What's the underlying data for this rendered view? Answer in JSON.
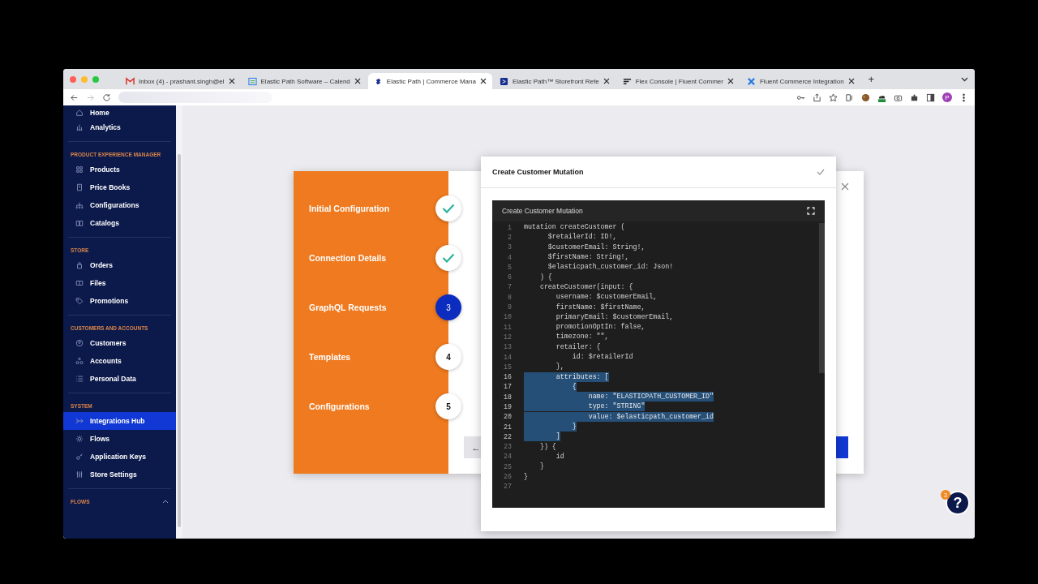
{
  "browser": {
    "tabs": [
      {
        "title": "Inbox (4) - prashant.singh@el",
        "kind": "mail",
        "selected": false
      },
      {
        "title": "Elastic Path Software – Calend",
        "kind": "calendar",
        "selected": false
      },
      {
        "title": "Elastic Path | Commerce Mana",
        "kind": "swirl",
        "selected": true
      },
      {
        "title": "Elastic Path™ Storefront Refe",
        "kind": "square",
        "selected": false
      },
      {
        "title": "Flex Console | Fluent Commer",
        "kind": "lines",
        "selected": false
      },
      {
        "title": "Fluent Commerce Integration",
        "kind": "cross",
        "selected": false
      }
    ],
    "new_tab": "+",
    "avatar": "P"
  },
  "sidebar": {
    "sections": [
      {
        "items": [
          {
            "label": "Home",
            "kind": "home",
            "selected": false
          },
          {
            "label": "Analytics",
            "kind": "chart",
            "selected": false
          }
        ]
      },
      {
        "heading": "PRODUCT EXPERIENCE MANAGER",
        "items": [
          {
            "label": "Products",
            "kind": "grid",
            "selected": false
          },
          {
            "label": "Price Books",
            "kind": "book",
            "selected": false
          },
          {
            "label": "Configurations",
            "kind": "tree",
            "selected": false
          },
          {
            "label": "Catalogs",
            "kind": "catalog",
            "selected": false
          }
        ]
      },
      {
        "heading": "STORE",
        "items": [
          {
            "label": "Orders",
            "kind": "bag",
            "selected": false
          },
          {
            "label": "Files",
            "kind": "files",
            "selected": false
          },
          {
            "label": "Promotions",
            "kind": "tag",
            "selected": false
          }
        ]
      },
      {
        "heading": "CUSTOMERS AND ACCOUNTS",
        "items": [
          {
            "label": "Customers",
            "kind": "person",
            "selected": false
          },
          {
            "label": "Accounts",
            "kind": "accounts",
            "selected": false
          },
          {
            "label": "Personal Data",
            "kind": "list",
            "selected": false
          }
        ]
      },
      {
        "heading": "SYSTEM",
        "items": [
          {
            "label": "Integrations Hub",
            "kind": "hub",
            "selected": true
          },
          {
            "label": "Flows",
            "kind": "gear",
            "selected": false
          },
          {
            "label": "Application Keys",
            "kind": "key",
            "selected": false
          },
          {
            "label": "Store Settings",
            "kind": "sliders",
            "selected": false
          }
        ]
      },
      {
        "heading": "FLOWS",
        "expanded": true
      }
    ]
  },
  "wizard": {
    "steps": [
      {
        "label": "Initial Configuration",
        "kind": "done"
      },
      {
        "label": "Connection Details",
        "kind": "done"
      },
      {
        "label": "GraphQL Requests",
        "kind": "current",
        "number": "3"
      },
      {
        "label": "Templates",
        "kind": "pending",
        "number": "4"
      },
      {
        "label": "Configurations",
        "kind": "pending",
        "number": "5"
      }
    ],
    "back_button": "←"
  },
  "code_dialog": {
    "title": "Create Customer Mutation",
    "confirmed": true,
    "editor": {
      "title": "Create Customer Mutation",
      "lines": [
        {
          "number": "1",
          "text": "mutation createCustomer (",
          "selected": false
        },
        {
          "number": "2",
          "text": "      $retailerId: ID!,",
          "selected": false
        },
        {
          "number": "3",
          "text": "      $customerEmail: String!,",
          "selected": false
        },
        {
          "number": "4",
          "text": "      $firstName: String!,",
          "selected": false
        },
        {
          "number": "5",
          "text": "      $elasticpath_customer_id: Json!",
          "selected": false
        },
        {
          "number": "6",
          "text": "    ) {",
          "selected": false
        },
        {
          "number": "7",
          "text": "    createCustomer(input: {",
          "selected": false
        },
        {
          "number": "8",
          "text": "        username: $customerEmail,",
          "selected": false
        },
        {
          "number": "9",
          "text": "        firstName: $firstName,",
          "selected": false
        },
        {
          "number": "10",
          "text": "        primaryEmail: $customerEmail,",
          "selected": false
        },
        {
          "number": "11",
          "text": "        promotionOptIn: false,",
          "selected": false
        },
        {
          "number": "12",
          "text": "        timezone: \"\",",
          "selected": false
        },
        {
          "number": "13",
          "text": "        retailer: {",
          "selected": false
        },
        {
          "number": "14",
          "text": "            id: $retailerId",
          "selected": false
        },
        {
          "number": "15",
          "text": "        },",
          "selected": false
        },
        {
          "number": "16",
          "text": "        attributes: [",
          "selected": true
        },
        {
          "number": "17",
          "text": "            {",
          "selected": true
        },
        {
          "number": "18",
          "text": "                name: \"ELASTICPATH_CUSTOMER_ID\"",
          "selected": true
        },
        {
          "number": "19",
          "text": "                type: \"STRING\"",
          "selected": true
        },
        {
          "number": "20",
          "text": "                value: $elasticpath_customer_id",
          "selected": true
        },
        {
          "number": "21",
          "text": "            }",
          "selected": true
        },
        {
          "number": "22",
          "text": "        ]",
          "selected": true
        },
        {
          "number": "23",
          "text": "    }) {",
          "selected": false
        },
        {
          "number": "24",
          "text": "        id",
          "selected": false
        },
        {
          "number": "25",
          "text": "    }",
          "selected": false
        },
        {
          "number": "26",
          "text": "}",
          "selected": false
        },
        {
          "number": "27",
          "selected": false
        }
      ]
    }
  },
  "help": {
    "label": "?",
    "badge": "3"
  }
}
